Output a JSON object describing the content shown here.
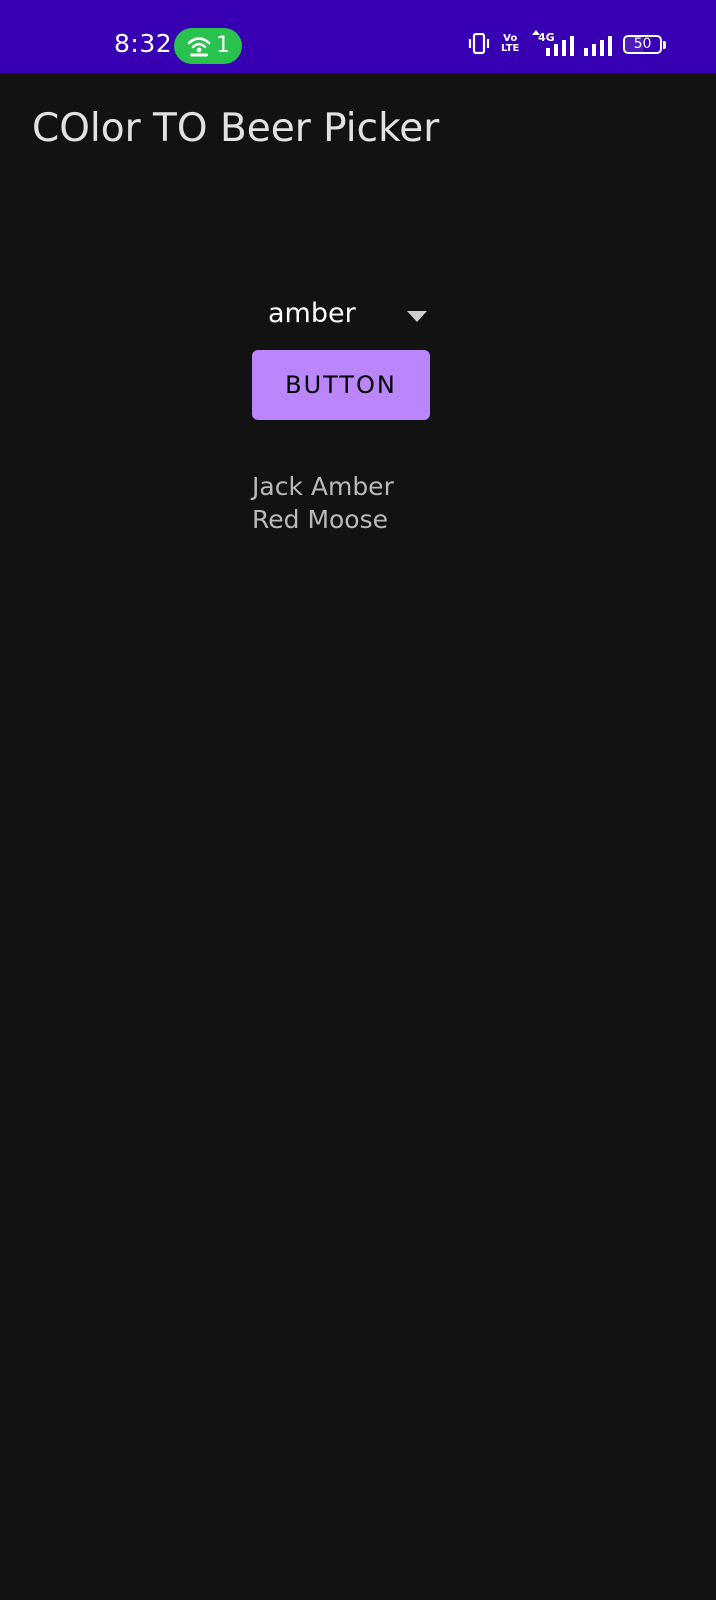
{
  "status_bar": {
    "time": "8:32",
    "hotspot_count": "1",
    "volte_line1": "Vo",
    "volte_line2": "LTE",
    "network_type": "4G",
    "battery_level": "50",
    "colors": {
      "background": "#3700b3",
      "hotspot": "#2ac24f"
    },
    "icons": [
      "hotspot-icon",
      "vibrate-icon",
      "signal-icon",
      "battery-icon"
    ]
  },
  "app": {
    "title": "COlor TO Beer Picker"
  },
  "spinner": {
    "selected": "amber"
  },
  "button": {
    "label": "BUTTON",
    "color": "#bb86fc"
  },
  "results": [
    "Jack Amber",
    "Red Moose"
  ]
}
